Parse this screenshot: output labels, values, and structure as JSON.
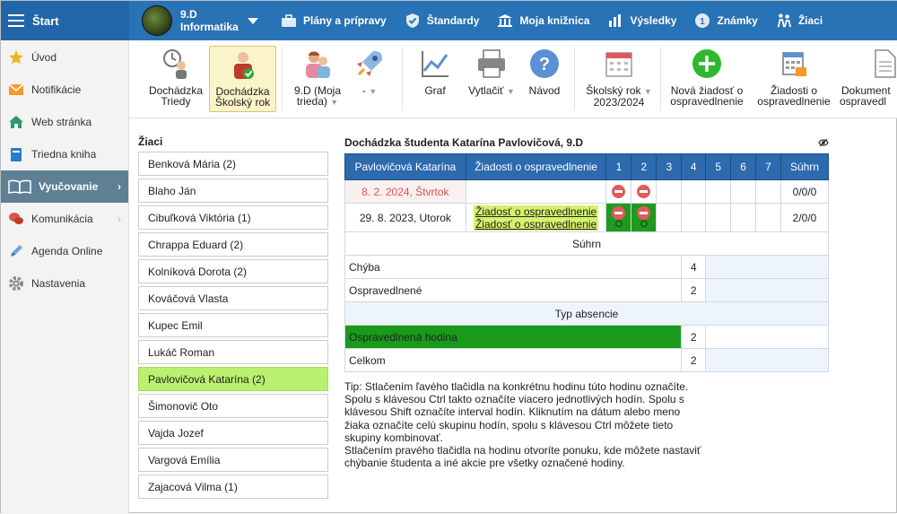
{
  "topbar": {
    "start_label": "Štart",
    "class_line1": "9.D",
    "class_line2": "Informatika",
    "nav": [
      {
        "label": "Plány a prípravy",
        "icon": "briefcase-icon"
      },
      {
        "label": "Štandardy",
        "icon": "shield-check-icon"
      },
      {
        "label": "Moja knižnica",
        "icon": "library-icon"
      },
      {
        "label": "Výsledky",
        "icon": "bar-chart-icon"
      },
      {
        "label": "Známky",
        "icon": "grades-icon"
      },
      {
        "label": "Žiaci",
        "icon": "students-icon"
      }
    ]
  },
  "sidebar": {
    "items": [
      {
        "label": "Úvod",
        "icon": "star-icon"
      },
      {
        "label": "Notifikácie",
        "icon": "envelope-icon"
      },
      {
        "label": "Web stránka",
        "icon": "home-icon"
      },
      {
        "label": "Triedna kniha",
        "icon": "book-icon"
      },
      {
        "label": "Vyučovanie",
        "icon": "open-book-icon"
      },
      {
        "label": "Komunikácia",
        "icon": "chat-icon"
      },
      {
        "label": "Agenda Online",
        "icon": "pen-icon"
      },
      {
        "label": "Nastavenia",
        "icon": "gear-icon"
      }
    ]
  },
  "toolbar": {
    "attendance_class_l1": "Dochádzka",
    "attendance_class_l2": "Triedy",
    "attendance_year_l1": "Dochádzka",
    "attendance_year_l2": "Školský rok",
    "class_sel_l1": "9.D (Moja",
    "class_sel_l2": "trieda)",
    "dash": "-",
    "graph": "Graf",
    "print": "Vytlačiť",
    "guide": "Návod",
    "school_year_l1": "Školský rok",
    "school_year_l2": "2023/2024",
    "new_request_l1": "Nová žiadosť o",
    "new_request_l2": "ospravedlnenie",
    "requests_l1": "Žiadosti o",
    "requests_l2": "ospravedlnenie",
    "documents_l1": "Dokument",
    "documents_l2": "ospravedl"
  },
  "students": {
    "title": "Žiaci",
    "list": [
      "Benková Mária (2)",
      "Blaho Ján",
      "Cibuľková Viktória (1)",
      "Chrappa Eduard (2)",
      "Kolníková Dorota (2)",
      "Kováčová Vlasta",
      "Kupec Emil",
      "Lukáč Roman",
      "Pavlovičová Katarína (2)",
      "Šimonovič Oto",
      "Vajda Jozef",
      "Vargová Emília",
      "Zajacová Vilma (1)"
    ],
    "selected_index": 8
  },
  "attendance": {
    "title": "Dochádzka študenta Katarína Pavlovičová, 9.D",
    "headers": {
      "student": "Pavlovičová Katarína",
      "requests": "Žiadosti o ospravedlnenie",
      "h1": "1",
      "h2": "2",
      "h3": "3",
      "h4": "4",
      "h5": "5",
      "h6": "6",
      "h7": "7",
      "sum": "Súhrn"
    },
    "rows": [
      {
        "date": "8. 2. 2024, Štvrtok",
        "sum": "0/0/0"
      },
      {
        "date": "29. 8. 2023, Utorok",
        "request1": "Žiadosť o ospravedlnenie",
        "request2": "Žiadosť o ospravedlnenie",
        "mark_o": "O",
        "sum": "2/0/0"
      }
    ],
    "summary_header": "Súhrn",
    "summary": [
      {
        "label": "Chýba",
        "value": "4"
      },
      {
        "label": "Ospravedlnené",
        "value": "2"
      }
    ],
    "type_header": "Typ absencie",
    "types": [
      {
        "label": "Ospravedlnená hodina",
        "value": "2",
        "color": "#1a9a1a"
      },
      {
        "label": "Celkom",
        "value": "2"
      }
    ]
  },
  "tip": {
    "line1": "Tip: Stlačením ľavého tlačidla na konkrétnu hodinu túto hodinu označíte.",
    "line2": "Spolu s klávesou Ctrl takto označíte viacero jednotlivých hodín. Spolu s",
    "line3": "klávesou Shift označíte interval hodín. Kliknutím na dátum alebo meno",
    "line4": "žiaka označíte celú skupinu hodín, spolu s klávesou Ctrl môžete tieto",
    "line5": "skupiny kombinovať.",
    "line6": "Stlačením pravého tlačidla na hodinu otvoríte ponuku, kde môžete nastaviť",
    "line7": "chýbanie študenta a iné akcie pre všetky označené hodiny."
  }
}
